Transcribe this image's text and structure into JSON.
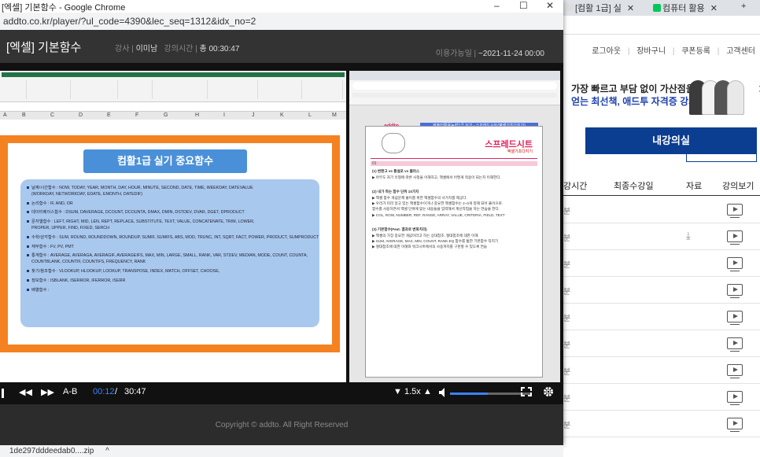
{
  "bg": {
    "tabs": [
      "[컴활 1급] 실",
      "컴퓨터 활용"
    ],
    "new_tab": "+",
    "nav": [
      "로그아웃",
      "장바구니",
      "쿠폰등록",
      "고객센터"
    ],
    "banner_line1": "가장 빠르고 부담 없이 가산점을",
    "banner_line2": "얻는 최선책, 애드투 자격증 강의",
    "banner_next": "›",
    "my_lecture": "내강의실",
    "table_headers": [
      "강시간",
      "최종수강일",
      "자료",
      "강의보기"
    ],
    "row_minutes": "분",
    "download_icon": "download-icon"
  },
  "window": {
    "title": "[엑셀] 기본함수 - Google Chrome",
    "url": "addto.co.kr/player/?ul_code=4390&lec_seq=1312&idx_no=2",
    "minimize": "–",
    "maximize": "☐",
    "close": "✕"
  },
  "player": {
    "course_title": "[엑셀] 기본함수",
    "teacher_label": "강사",
    "teacher": "이미남",
    "duration_label": "강의시간",
    "duration": "총 00:30:47",
    "avail_label": "이용가능일",
    "avail": "~2021-11-24 00:00"
  },
  "slide": {
    "title": "컴활1급 실기 중요함수",
    "items": [
      "날짜/시간함수 : NOW, TODAY, YEAR, MONTH, DAY, HOUR, MINUTE, SECOND, DATE, TIME, WEEKDAY, DATEVALUE",
      "(WORKDAY, NETWORKDAY, EDATE, EMONTH, DATEDIF)",
      "논리함수 : IF, AND, OR",
      "데이터베이스함수 : DSUM, DAVERAGE, DCOUNT, DCOUNTA, DMAX, DMIN, DSTDEV, DVAR, DGET, DPRODUCT",
      "문자열함수 : LEFT, RIGHT, MID, LEN, REPT, REPLACE, SUBSTITUTE, TEXT, VALUE, CONCATENATE, TRIM, LOWER,",
      "PROPER, UPPER, FIND, FIXED, SERCH",
      "수학/삼각함수 : SUM, ROUND, ROUNDDOWN, ROUNDUP, SUMIF, SUMIFS, ABS, MOD, TRUNC, INT, SQRT, FACT, POWER, PRODUCT, SUMPRODUCT",
      "재무함수 : FV, PV, PMT",
      "통계함수 : AVERAGE, AVERAGA, AVERAGIF, AVERAGEIFS, MAX, MIN, LARGE, SMALL, RANK, VAR, STDEV, MEDIAN, MODE, COUNT, COUNTA,",
      "COUNTBLANK, COUNTIF, COUNTIFS, FREQUENCY, RANK",
      "찾기/참조함수 : VLOOKUP, HLOOKUP, LOOKUP, TRANSPOSE, INDEX, MATCH, OFFSET, CHOOSE,",
      "정보함수 : ISBLANK, ISERROR, IFERROR, ISERR",
      "배열함수 :"
    ],
    "item_bullets": [
      true,
      false,
      true,
      true,
      true,
      false,
      true,
      true,
      true,
      false,
      true,
      true,
      true
    ],
    "columns": [
      "A",
      "B",
      "C",
      "D",
      "E",
      "F",
      "G",
      "H",
      "I",
      "J",
      "K",
      "L",
      "M"
    ]
  },
  "pdf": {
    "brand": "addto",
    "header": "컴퓨터활용능력1급 실기 - 스프레드시트(엑셀기초다지기)",
    "title": "스프레드시트",
    "subtitle": "엑셀기초다지기",
    "section": "01",
    "lines": [
      "(1) 변환고 vs 통설포 vs 플러스",
      "▶ 아무도 자기 유형에 따른 사정을 이해하고, 엑셀에서 어떻게 적용이 되는지 이해한다.",
      "(2) 내가 하는 함수 단위 10가지",
      "▶ 엑셀 함수 개념문제 풀이를 위한 엑셀함수의 사가지를 제공다.",
      "▶ 우리가 미리 알고 있는 엑셀함수이거나 중요한 엑셀함수는 2~3개 정해 되어 풀이으로.",
      "   함수를 사용하면서 엑셀 단위에 맞는 내용들을 입력해서 계산작업을 하는 연습을 한다.",
      "▶ COL, ROW, NUMBER, REF, RANGE, ARRAY, VALUE, CRITERIA, FIELD, TEXT",
      "(3) 기본함수(Feat. 결과로 변화치리)",
      "▶ 엑셀의 가장 중요한 개념이라고 하는 상대참조, 절대참조에 대한 이해",
      "▶ SUM, AVERAGE, MAX, MIN, COUNT, RANK.EQ 함수를 통한 기본함수 익히기",
      "▶ 절대참조에 대한 이해와 워크시트에서의 사용까지를 구분할 수 있도록 연습"
    ]
  },
  "controls": {
    "rewind": "◀◀",
    "forward": "▶▶",
    "ab": "A-B",
    "current": "00:12",
    "separator": "/",
    "total": "30:47",
    "speed": "1.5x",
    "speed_down": "▼",
    "speed_up": "▲",
    "volume_icon": "volume-icon",
    "volume_level": 0.46,
    "fullscreen_icon": "fullscreen-icon",
    "settings_icon": "gear-icon"
  },
  "footer": "Copyright © addto. All Right Reserved",
  "download": {
    "file": "1de297dddeedab0....zip",
    "chevron": "^"
  }
}
